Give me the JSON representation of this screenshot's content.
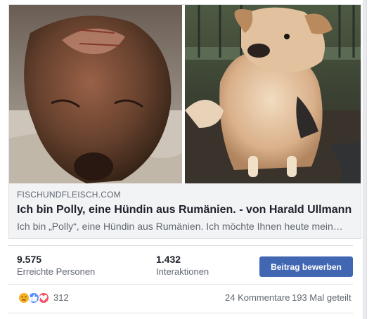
{
  "link_preview": {
    "domain": "FISCHUNDFLEISCH.COM",
    "title": "Ich bin Polly, eine Hündin aus Rumänien. - von Harald Ullmann",
    "description": "Ich bin „Polly“, eine Hündin aus Rumänien. Ich möchte Ihnen heute mein…"
  },
  "stats": {
    "reach_value": "9.575",
    "reach_label": "Erreichte Personen",
    "engagement_value": "1.432",
    "engagement_label": "Interaktionen",
    "boost_label": "Beitrag bewerben"
  },
  "reactions": {
    "icons": [
      "sad-reaction-icon",
      "like-reaction-icon",
      "love-reaction-icon"
    ],
    "count": "312",
    "comments": "24 Kommentare",
    "shares": "193 Mal geteilt"
  },
  "colors": {
    "accent": "#4267b2",
    "secondary_text": "#606770",
    "like": "#5890ff",
    "love": "#f25268",
    "sad": "#f7b125"
  }
}
